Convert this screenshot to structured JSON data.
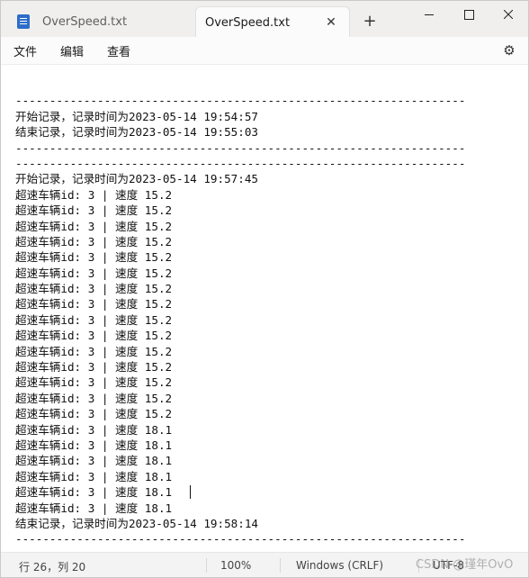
{
  "tabs": [
    {
      "label": "OverSpeed.txt",
      "active": false
    },
    {
      "label": "OverSpeed.txt",
      "active": true
    }
  ],
  "tab_close_glyph": "✕",
  "new_tab_glyph": "+",
  "menu": {
    "file": "文件",
    "edit": "编辑",
    "view": "查看"
  },
  "settings_glyph": "⚙",
  "content_lines": [
    "",
    "------------------------------------------------------------------",
    "开始记录，记录时间为2023-05-14 19:54:57",
    "结束记录，记录时间为2023-05-14 19:55:03",
    "------------------------------------------------------------------",
    "------------------------------------------------------------------",
    "开始记录，记录时间为2023-05-14 19:57:45",
    "超速车辆id: 3 | 速度 15.2",
    "超速车辆id: 3 | 速度 15.2",
    "超速车辆id: 3 | 速度 15.2",
    "超速车辆id: 3 | 速度 15.2",
    "超速车辆id: 3 | 速度 15.2",
    "超速车辆id: 3 | 速度 15.2",
    "超速车辆id: 3 | 速度 15.2",
    "超速车辆id: 3 | 速度 15.2",
    "超速车辆id: 3 | 速度 15.2",
    "超速车辆id: 3 | 速度 15.2",
    "超速车辆id: 3 | 速度 15.2",
    "超速车辆id: 3 | 速度 15.2",
    "超速车辆id: 3 | 速度 15.2",
    "超速车辆id: 3 | 速度 15.2",
    "超速车辆id: 3 | 速度 15.2",
    "超速车辆id: 3 | 速度 18.1",
    "超速车辆id: 3 | 速度 18.1",
    "超速车辆id: 3 | 速度 18.1",
    "超速车辆id: 3 | 速度 18.1",
    "超速车辆id: 3 | 速度 18.1",
    "超速车辆id: 3 | 速度 18.1",
    "结束记录，记录时间为2023-05-14 19:58:14",
    "------------------------------------------------------------------"
  ],
  "status": {
    "position": "行 26，列 20",
    "zoom": "100%",
    "line_ending": "Windows (CRLF)",
    "encoding": "UTF-8"
  },
  "watermark": "CSDN @瑾年OvO"
}
